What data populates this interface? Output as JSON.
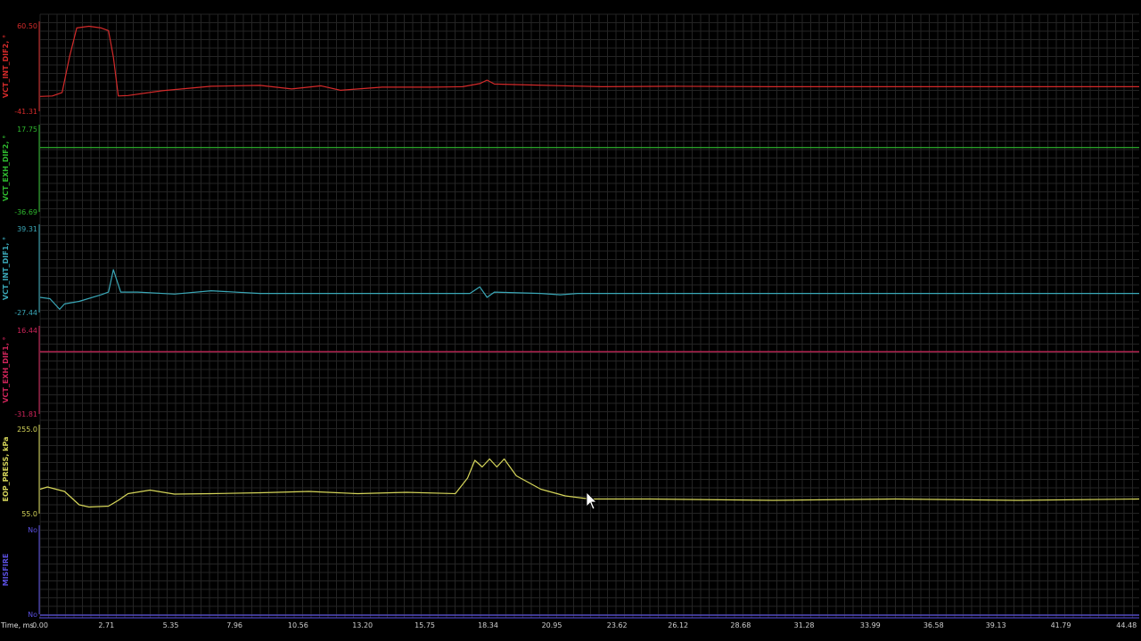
{
  "chart_data": {
    "type": "line",
    "grid": true,
    "x_axis": {
      "label": "Time, ms",
      "unit": "ms",
      "range": [
        0,
        45.0
      ],
      "ticks": [
        "0.00",
        "2.71",
        "5.35",
        "7.96",
        "10.56",
        "13.20",
        "15.75",
        "18.34",
        "20.95",
        "23.62",
        "26.12",
        "28.68",
        "31.28",
        "33.99",
        "36.58",
        "39.13",
        "41.79",
        "44.48"
      ]
    },
    "channels": [
      {
        "name": "VCT_INT_DIF2, °",
        "color": "#d42a2a",
        "max_label": "60.50",
        "min_label": "-41.31",
        "range": [
          -41.31,
          60.5
        ],
        "points": [
          [
            0,
            -24.5
          ],
          [
            0.5,
            -24
          ],
          [
            0.9,
            -20
          ],
          [
            1.2,
            20
          ],
          [
            1.5,
            53
          ],
          [
            2.0,
            55
          ],
          [
            2.5,
            53
          ],
          [
            2.8,
            50
          ],
          [
            3.0,
            20
          ],
          [
            3.2,
            -24
          ],
          [
            3.6,
            -23.5
          ],
          [
            5,
            -18
          ],
          [
            7,
            -13
          ],
          [
            9,
            -12
          ],
          [
            10.3,
            -16
          ],
          [
            11.5,
            -12.5
          ],
          [
            12.3,
            -17.5
          ],
          [
            14,
            -14
          ],
          [
            16,
            -14
          ],
          [
            17.3,
            -13.5
          ],
          [
            18.0,
            -10
          ],
          [
            18.3,
            -6
          ],
          [
            18.6,
            -10.5
          ],
          [
            20,
            -11.5
          ],
          [
            23,
            -13.5
          ],
          [
            26,
            -13
          ],
          [
            30,
            -13.5
          ],
          [
            35,
            -13.5
          ],
          [
            40,
            -13.5
          ],
          [
            45,
            -13.5
          ]
        ]
      },
      {
        "name": "VCT_EXH_DIF2, °",
        "color": "#2eb82e",
        "max_label": "17.75",
        "min_label": "-36.69",
        "range": [
          -36.69,
          17.75
        ],
        "points": [
          [
            0,
            3.5
          ],
          [
            45,
            3.5
          ]
        ]
      },
      {
        "name": "VCT_INT_DIF1, °",
        "color": "#3aa8b8",
        "max_label": "39.31",
        "min_label": "-27.44",
        "range": [
          -27.44,
          39.31
        ],
        "points": [
          [
            0,
            -16
          ],
          [
            0.4,
            -17
          ],
          [
            0.8,
            -25
          ],
          [
            1.0,
            -21
          ],
          [
            1.6,
            -19
          ],
          [
            2.5,
            -14
          ],
          [
            2.8,
            -12
          ],
          [
            3.0,
            5
          ],
          [
            3.3,
            -12
          ],
          [
            4.0,
            -12
          ],
          [
            5.5,
            -13.5
          ],
          [
            7,
            -11
          ],
          [
            9,
            -13
          ],
          [
            12,
            -13
          ],
          [
            15,
            -13
          ],
          [
            17.6,
            -13
          ],
          [
            18.0,
            -8
          ],
          [
            18.3,
            -16
          ],
          [
            18.6,
            -12
          ],
          [
            20.5,
            -13
          ],
          [
            21.3,
            -14
          ],
          [
            22,
            -13
          ],
          [
            30,
            -13
          ],
          [
            38,
            -13
          ],
          [
            45,
            -13
          ]
        ]
      },
      {
        "name": "VCT_EXH_DIF1, °",
        "color": "#d0245a",
        "max_label": "16.44",
        "min_label": "-31.81",
        "range": [
          -31.81,
          16.44
        ],
        "points": [
          [
            0,
            2.3
          ],
          [
            45,
            2.3
          ]
        ]
      },
      {
        "name": "EOP_PRESS, kPa",
        "color": "#d6d65a",
        "max_label": "255.0",
        "min_label": "55.0",
        "range": [
          55.0,
          255.0
        ],
        "points": [
          [
            0,
            110
          ],
          [
            0.3,
            115
          ],
          [
            1.0,
            105
          ],
          [
            1.6,
            75
          ],
          [
            2.0,
            70
          ],
          [
            2.8,
            72
          ],
          [
            3.2,
            85
          ],
          [
            3.6,
            100
          ],
          [
            4.5,
            108
          ],
          [
            5.5,
            99
          ],
          [
            7,
            100
          ],
          [
            9,
            102
          ],
          [
            11,
            105
          ],
          [
            13,
            100
          ],
          [
            15,
            103
          ],
          [
            17.0,
            100
          ],
          [
            17.5,
            135
          ],
          [
            17.8,
            175
          ],
          [
            18.1,
            160
          ],
          [
            18.4,
            178
          ],
          [
            18.7,
            160
          ],
          [
            19.0,
            178
          ],
          [
            19.5,
            140
          ],
          [
            20.5,
            110
          ],
          [
            21.5,
            95
          ],
          [
            22.5,
            88
          ],
          [
            25,
            88
          ],
          [
            30,
            85
          ],
          [
            35,
            88
          ],
          [
            40,
            85
          ],
          [
            45,
            88
          ]
        ]
      },
      {
        "name": "MISFIRE",
        "color": "#5a4fe0",
        "max_label": "No",
        "min_label": "No",
        "categories": [
          "No"
        ],
        "points": [
          [
            0,
            0
          ],
          [
            45,
            0
          ]
        ]
      }
    ]
  }
}
